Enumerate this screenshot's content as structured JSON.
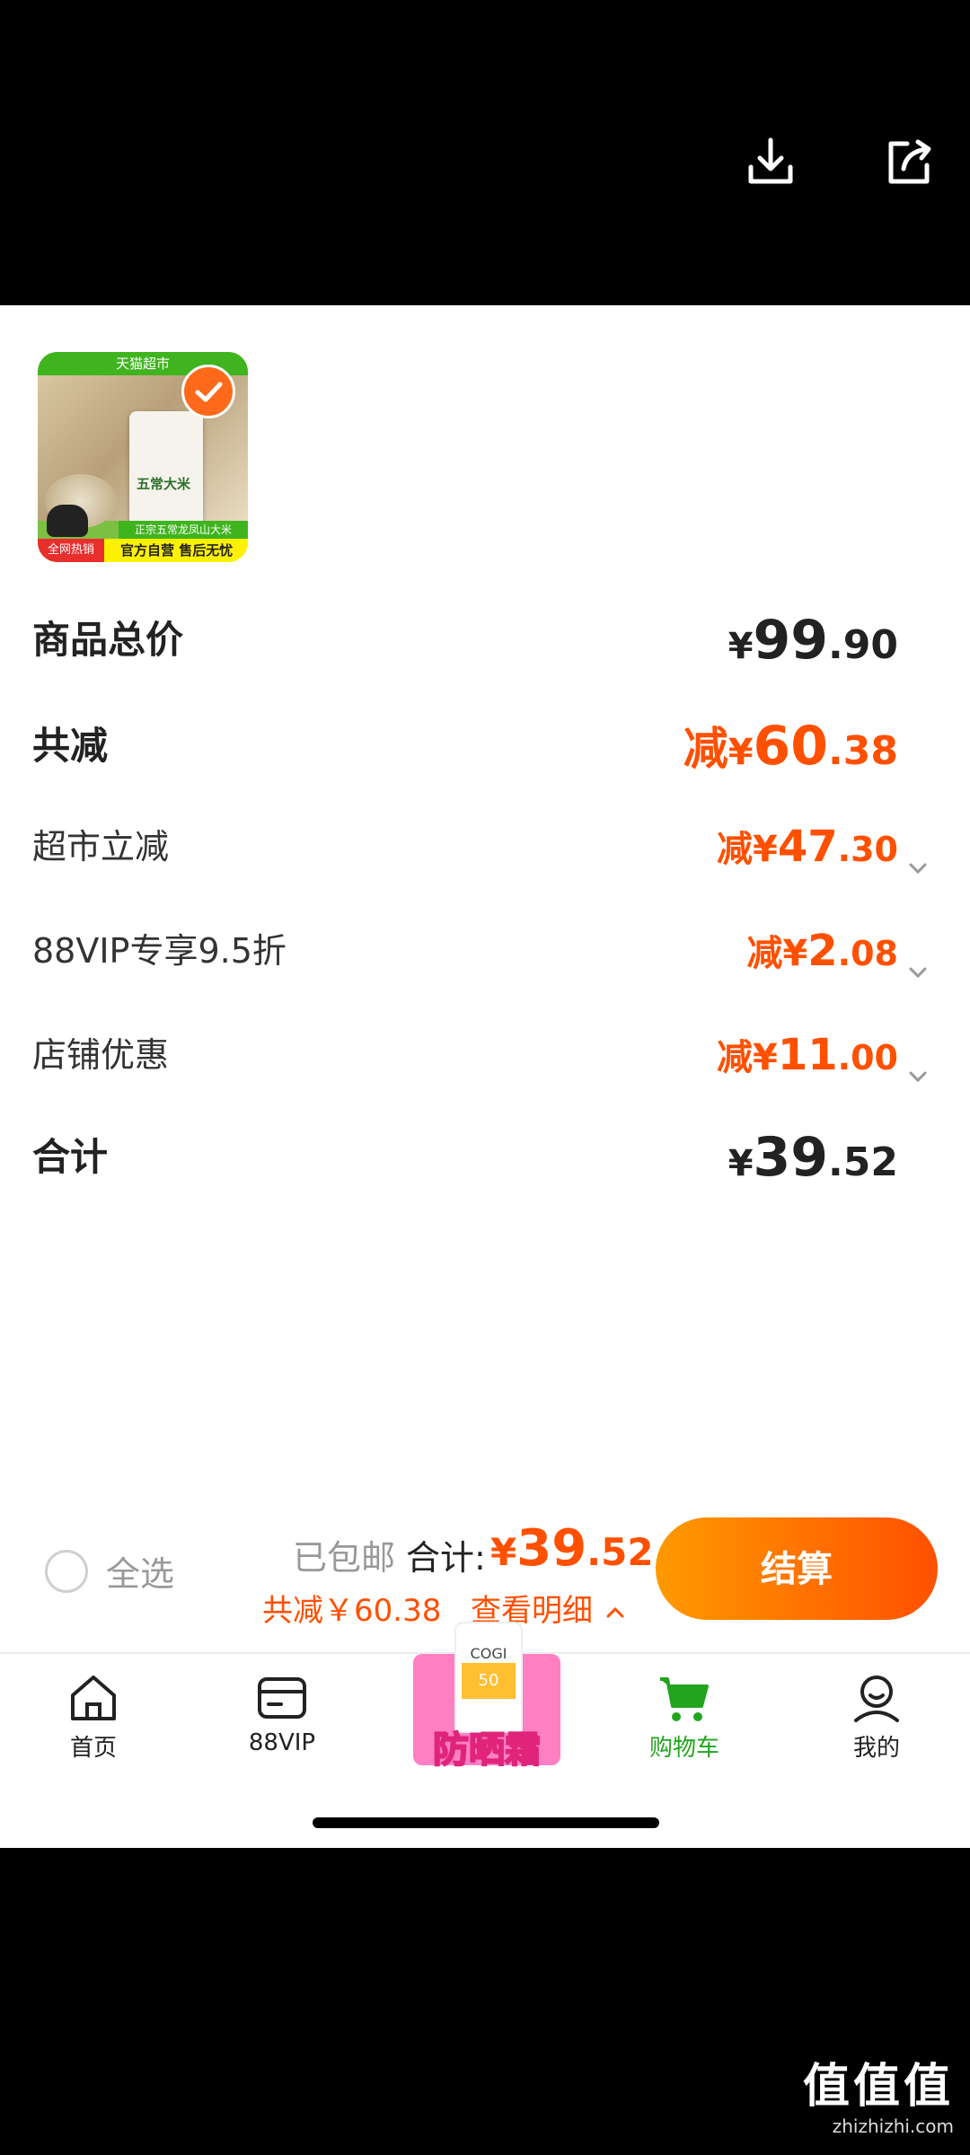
{
  "topbar": {
    "download_icon": "download-icon",
    "share_icon": "share-icon"
  },
  "product": {
    "top_strip": "天猫超市",
    "bag_name": "五常大米",
    "mid_strip": "正宗五常龙凤山大米",
    "left_tag": "全网热销",
    "bottom_strip": "官方自营 售后无忧",
    "selected": true
  },
  "rows": [
    {
      "label": "商品总价",
      "minus": "",
      "yen": "¥",
      "int": "99",
      "dec": ".90",
      "style": "big-black"
    },
    {
      "label": "共减",
      "minus": "减",
      "yen": "¥",
      "int": "60",
      "dec": ".38",
      "style": "big-orange"
    },
    {
      "label": "超市立减",
      "minus": "减",
      "yen": "¥",
      "int": "47",
      "dec": ".30",
      "style": "small-orange"
    },
    {
      "label": "88VIP专享9.5折",
      "minus": "减",
      "yen": "¥",
      "int": "2",
      "dec": ".08",
      "style": "small-orange"
    },
    {
      "label": "店铺优惠",
      "minus": "减",
      "yen": "¥",
      "int": "11",
      "dec": ".00",
      "style": "small-orange"
    },
    {
      "label": "合计",
      "minus": "",
      "yen": "¥",
      "int": "39",
      "dec": ".52",
      "style": "big-black"
    }
  ],
  "checkout": {
    "select_all": "全选",
    "shipping": "已包邮",
    "total_label": "合计:",
    "total_yen": "¥",
    "total_int": "39",
    "total_dec": ".52",
    "saving": "共减￥60.38",
    "detail": "查看明细",
    "pay": "结算"
  },
  "tabs": [
    {
      "label": "首页",
      "icon": "home-icon"
    },
    {
      "label": "88VIP",
      "icon": "card-icon"
    },
    {
      "label": "购物车",
      "icon": "cart-icon",
      "active": true
    },
    {
      "label": "我的",
      "icon": "profile-icon"
    }
  ],
  "promo": {
    "brand": "COGI",
    "spf": "50",
    "caption": "防晒霜"
  },
  "watermark": {
    "mark": "值值值",
    "site": "zhizhizhi.com"
  },
  "colors": {
    "accent": "#ff5000",
    "green": "#22a51e"
  }
}
